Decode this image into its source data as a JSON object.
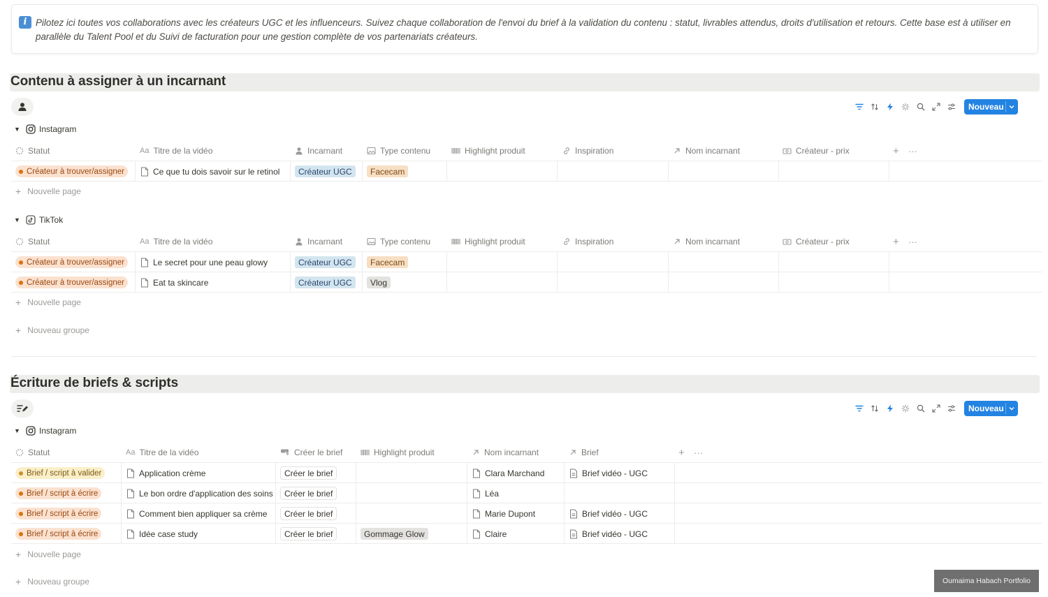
{
  "callout": {
    "icon": "info-icon",
    "text": "Pilotez ici toutes vos collaborations avec les créateurs UGC et les influenceurs. Suivez chaque collaboration de l'envoi du brief à la validation du contenu : statut, livrables attendus, droits d'utilisation et retours. Cette base est à utiliser en parallèle du Talent Pool et du Suivi de facturation pour une gestion complète de vos partenariats créateurs."
  },
  "colors": {
    "accent": "#2383e2",
    "status_orange_bg": "#fbe1cf",
    "status_orange_dot": "#d9730d",
    "status_yellow_bg": "#fbefc9",
    "status_yellow_dot": "#cb912f",
    "tag_blue_bg": "#d3e5ef",
    "tag_orange_bg": "#f7dfc4",
    "tag_gray_bg": "#e3e2e0"
  },
  "toolbar": {
    "new_label": "Nouveau",
    "icons": [
      "filter-icon",
      "sort-icon",
      "automation-bolt-icon",
      "ai-sparkle-icon",
      "search-icon",
      "expand-icon",
      "settings-sliders-icon"
    ]
  },
  "section1": {
    "title": "Contenu à assigner à un incarnant",
    "view_icon": "person-icon",
    "columns": [
      {
        "label": "Statut",
        "icon": "status-icon"
      },
      {
        "label": "Titre de la vidéo",
        "icon": "title-aa-icon"
      },
      {
        "label": "Incarnant",
        "icon": "person-icon"
      },
      {
        "label": "Type contenu",
        "icon": "image-icon"
      },
      {
        "label": "Highlight produit",
        "icon": "barcode-icon"
      },
      {
        "label": "Inspiration",
        "icon": "link-icon"
      },
      {
        "label": "Nom incarnant",
        "icon": "relation-arrow-icon"
      },
      {
        "label": "Créateur - prix",
        "icon": "money-icon"
      }
    ],
    "groups": [
      {
        "name": "Instagram",
        "icon": "instagram-icon",
        "rows": [
          {
            "statut": "Créateur à trouver/assigner",
            "titre": "Ce que tu dois savoir sur le retinol",
            "incarnant": "Créateur UGC",
            "type": "Facecam"
          }
        ]
      },
      {
        "name": "TikTok",
        "icon": "tiktok-icon",
        "rows": [
          {
            "statut": "Créateur à trouver/assigner",
            "titre": "Le secret pour une peau glowy",
            "incarnant": "Créateur UGC",
            "type": "Facecam"
          },
          {
            "statut": "Créateur à trouver/assigner",
            "titre": "Eat ta skincare",
            "incarnant": "Créateur UGC",
            "type": "Vlog"
          }
        ]
      }
    ],
    "new_page": "Nouvelle page",
    "new_group": "Nouveau groupe"
  },
  "section2": {
    "title": "Écriture de briefs & scripts",
    "view_icon": "pen-list-icon",
    "columns": [
      {
        "label": "Statut",
        "icon": "status-icon"
      },
      {
        "label": "Titre de la vidéo",
        "icon": "title-aa-icon"
      },
      {
        "label": "Créer le brief",
        "icon": "button-cursor-icon"
      },
      {
        "label": "Highlight produit",
        "icon": "barcode-icon"
      },
      {
        "label": "Nom incarnant",
        "icon": "relation-arrow-icon"
      },
      {
        "label": "Brief",
        "icon": "relation-arrow-icon"
      }
    ],
    "groups": [
      {
        "name": "Instagram",
        "icon": "instagram-icon",
        "rows": [
          {
            "statut": "Brief / script à valider",
            "titre": "Application crème",
            "bouton": "Créer le brief",
            "highlight": "",
            "nom": "Clara Marchand",
            "brief": "Brief vidéo - UGC"
          },
          {
            "statut": "Brief / script à écrire",
            "titre": "Le bon ordre d'application des soins",
            "bouton": "Créer le brief",
            "highlight": "",
            "nom": "Léa",
            "brief": ""
          },
          {
            "statut": "Brief / script à écrire",
            "titre": "Comment bien appliquer sa crème",
            "bouton": "Créer le brief",
            "highlight": "",
            "nom": "Marie Dupont",
            "brief": "Brief vidéo - UGC"
          },
          {
            "statut": "Brief / script à écrire",
            "titre": "Idée case study",
            "bouton": "Créer le brief",
            "highlight": "Gommage Glow",
            "nom": "Claire",
            "brief": "Brief vidéo - UGC"
          }
        ]
      }
    ],
    "new_page": "Nouvelle page",
    "new_group": "Nouveau groupe"
  },
  "watermark": "Oumaima Habach  Portfolio"
}
